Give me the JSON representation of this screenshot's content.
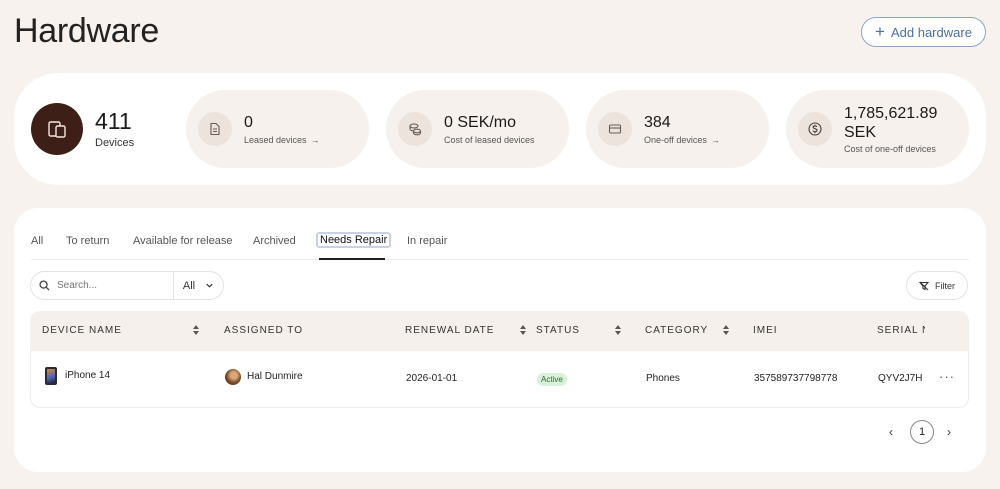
{
  "page": {
    "title": "Hardware",
    "add_button": "Add hardware"
  },
  "stats": {
    "devices": {
      "value": "411",
      "label": "Devices",
      "icon": "devices-icon"
    },
    "leased": {
      "value": "0",
      "label": "Leased devices",
      "icon": "document-icon"
    },
    "lease_cost": {
      "value": "0 SEK/mo",
      "label": "Cost of leased devices",
      "icon": "coins-icon"
    },
    "one_off": {
      "value": "384",
      "label": "One-off devices",
      "icon": "card-icon"
    },
    "one_off_cost": {
      "value_line1": "1,785,621.89",
      "value_line2": "SEK",
      "label": "Cost of one-off devices",
      "icon": "dollar-icon"
    }
  },
  "tabs": [
    {
      "label": "All"
    },
    {
      "label": "To return"
    },
    {
      "label": "Available for release"
    },
    {
      "label": "Archived"
    },
    {
      "label": "Needs Repair",
      "active": true
    },
    {
      "label": "In repair"
    }
  ],
  "search": {
    "placeholder": "Search...",
    "scope": "All"
  },
  "filter": {
    "label": "Filter"
  },
  "table": {
    "columns": [
      "DEVICE NAME",
      "ASSIGNED TO",
      "RENEWAL DATE",
      "STATUS",
      "CATEGORY",
      "IMEI",
      "SERIAL N"
    ],
    "rows": [
      {
        "device": "iPhone 14",
        "assigned": "Hal Dunmire",
        "renewal": "2026-01-01",
        "status": "Active",
        "category": "Phones",
        "imei": "357589737798778",
        "serial": "QYV2J7H"
      }
    ]
  },
  "pagination": {
    "current": "1"
  },
  "colors": {
    "background": "#f7f2ee",
    "accent_dark": "#3e1f17",
    "add_button_text": "#4c6f9f",
    "status_active_bg": "#d9f0d9"
  }
}
